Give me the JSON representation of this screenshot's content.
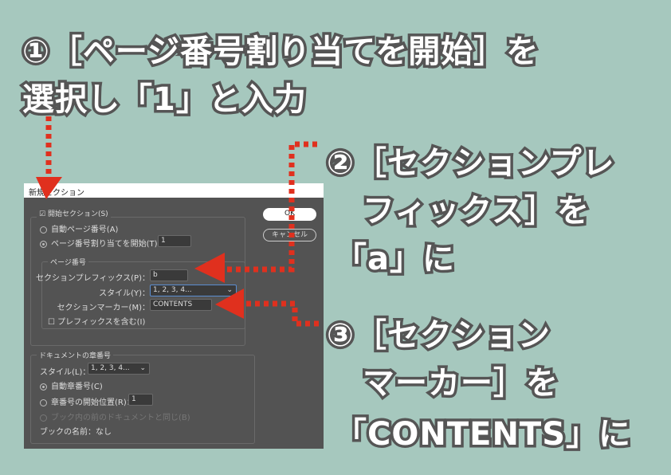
{
  "instructions": {
    "step1": [
      "①［ページ番号割り当てを開始］を",
      "選択し「1」と入力"
    ],
    "step2": [
      "②［セクションプレ",
      "フィックス］を",
      "「a」に"
    ],
    "step3": [
      "③［セクション",
      "マーカー］を",
      "「CONTENTS」に"
    ]
  },
  "dialog": {
    "title": "新規セクション",
    "start_section": "開始セクション(S)",
    "ok": "OK",
    "cancel": "キャンセル",
    "auto_page": "自動ページ番号(A)",
    "start_page": "ページ番号割り当てを開始(T)：",
    "start_page_value": "1",
    "page_group": "ページ番号",
    "prefix_label": "セクションプレフィックス(P)：",
    "prefix_value": "b",
    "style_label": "スタイル(Y)：",
    "style_value": "1, 2, 3, 4...",
    "marker_label": "セクションマーカー(M)：",
    "marker_value": "CONTENTS",
    "include_prefix": "プレフィックスを含む(I)",
    "chapter_group": "ドキュメントの章番号",
    "ch_style_label": "スタイル(L)：",
    "ch_style_value": "1, 2, 3, 4...",
    "auto_chapter": "自動章番号(C)",
    "start_chapter": "章番号の開始位置(R)：",
    "start_chapter_value": "1",
    "same_as_prev": "ブック内の前のドキュメントと同じ(B)",
    "book_name": "ブックの名前：なし"
  },
  "colors": {
    "background": "#a6c8be",
    "arrow": "#e0301e"
  }
}
